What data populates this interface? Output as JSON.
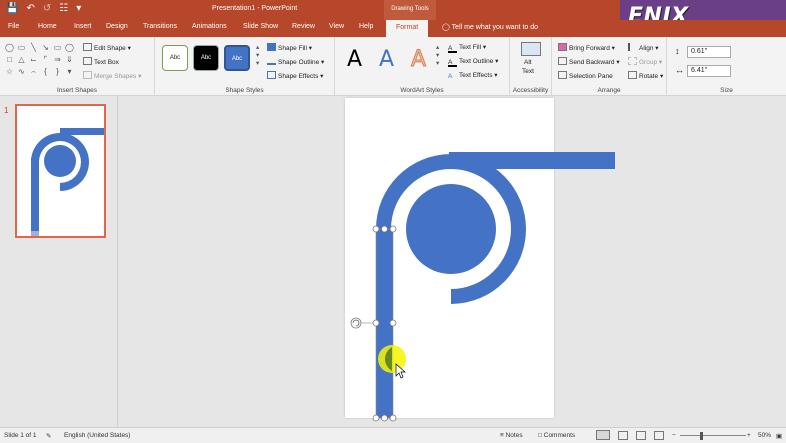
{
  "window": {
    "title": "Presentation1  -  PowerPoint",
    "context_label": "Drawing Tools",
    "brand": "ENIX Tutorials"
  },
  "tabs": [
    "File",
    "Home",
    "Insert",
    "Design",
    "Transitions",
    "Animations",
    "Slide Show",
    "Review",
    "View",
    "Help",
    "Format"
  ],
  "active_tab": "Format",
  "tell_me": "Tell me what you want to do",
  "ribbon": {
    "insert_shapes": {
      "label": "Insert Shapes",
      "edit_shape": "Edit Shape",
      "text_box": "Text Box",
      "merge_shapes": "Merge Shapes"
    },
    "shape_styles": {
      "label": "Shape Styles",
      "abc": "Abc",
      "fill": "Shape Fill",
      "outline": "Shape Outline",
      "effects": "Shape Effects"
    },
    "wordart": {
      "label": "WordArt Styles",
      "letter": "A",
      "fill": "Text Fill",
      "outline": "Text Outline",
      "effects": "Text Effects"
    },
    "accessibility": {
      "label": "Accessibility",
      "alt_text_1": "Alt",
      "alt_text_2": "Text"
    },
    "arrange": {
      "label": "Arrange",
      "bring_forward": "Bring Forward",
      "send_backward": "Send Backward",
      "selection_pane": "Selection Pane",
      "align": "Align",
      "group": "Group",
      "rotate": "Rotate"
    },
    "size": {
      "label": "Size",
      "height": "0.61\"",
      "width": "6.41\""
    }
  },
  "slides_pane": {
    "slide_number": "1"
  },
  "status": {
    "slide": "Slide 1 of 1",
    "language": "English (United States)",
    "notes": "Notes",
    "comments": "Comments",
    "zoom": "50%"
  },
  "colors": {
    "accent": "#b7472a",
    "shape_blue": "#4472c4",
    "highlight": "#f5f500"
  }
}
